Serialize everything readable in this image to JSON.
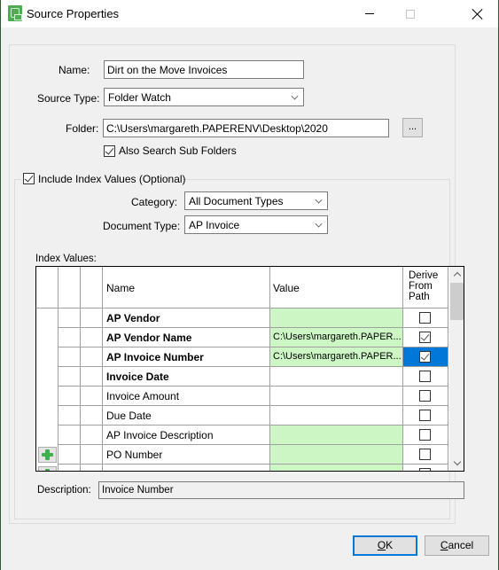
{
  "window": {
    "title": "Source Properties",
    "icon": "source-app-icon",
    "controls": [
      "minimize",
      "maximize",
      "close"
    ]
  },
  "form": {
    "name_label": "Name:",
    "name_value": "Dirt on the Move Invoices",
    "source_type_label": "Source Type:",
    "source_type_value": "Folder Watch",
    "folder_label": "Folder:",
    "folder_value": "C:\\Users\\margareth.PAPERENV\\Desktop\\2020",
    "browse_label": "...",
    "also_search_label": "Also Search Sub Folders",
    "also_search_checked": true
  },
  "index_group": {
    "include_label": "Include Index Values (Optional)",
    "include_checked": true,
    "category_label": "Category:",
    "category_value": "All Document Types",
    "document_type_label": "Document Type:",
    "document_type_value": "AP Invoice",
    "index_values_label": "Index Values:"
  },
  "grid": {
    "columns": {
      "name": "Name",
      "value": "Value",
      "derive": [
        "Derive",
        "From",
        "Path"
      ]
    },
    "rows": [
      {
        "name": "AP Vendor",
        "value": "",
        "bold": true,
        "green": true,
        "derive": false,
        "add": false,
        "selected": false
      },
      {
        "name": "AP Vendor Name",
        "value": "C:\\Users\\margareth.PAPER...",
        "bold": true,
        "green": true,
        "derive": true,
        "add": false,
        "selected": false
      },
      {
        "name": "AP Invoice Number",
        "value": "C:\\Users\\margareth.PAPER...",
        "bold": true,
        "green": true,
        "derive": true,
        "add": false,
        "selected": true
      },
      {
        "name": "Invoice Date",
        "value": "",
        "bold": true,
        "green": false,
        "derive": false,
        "add": false,
        "selected": false
      },
      {
        "name": "Invoice Amount",
        "value": "",
        "bold": false,
        "green": false,
        "derive": false,
        "add": false,
        "selected": false
      },
      {
        "name": "Due Date",
        "value": "",
        "bold": false,
        "green": false,
        "derive": false,
        "add": false,
        "selected": false
      },
      {
        "name": "AP Invoice Description",
        "value": "",
        "bold": false,
        "green": true,
        "derive": false,
        "add": false,
        "selected": false
      },
      {
        "name": "PO Number",
        "value": "",
        "bold": false,
        "green": true,
        "derive": false,
        "add": true,
        "selected": false
      },
      {
        "name": "",
        "value": "",
        "bold": false,
        "green": true,
        "derive": false,
        "add": true,
        "selected": false
      }
    ]
  },
  "description": {
    "label": "Description:",
    "value": "Invoice Number"
  },
  "buttons": {
    "ok_prefix": "",
    "ok_mnemonic": "O",
    "ok_rest": "K",
    "cancel_mnemonic": "C",
    "cancel_rest": "ancel"
  }
}
